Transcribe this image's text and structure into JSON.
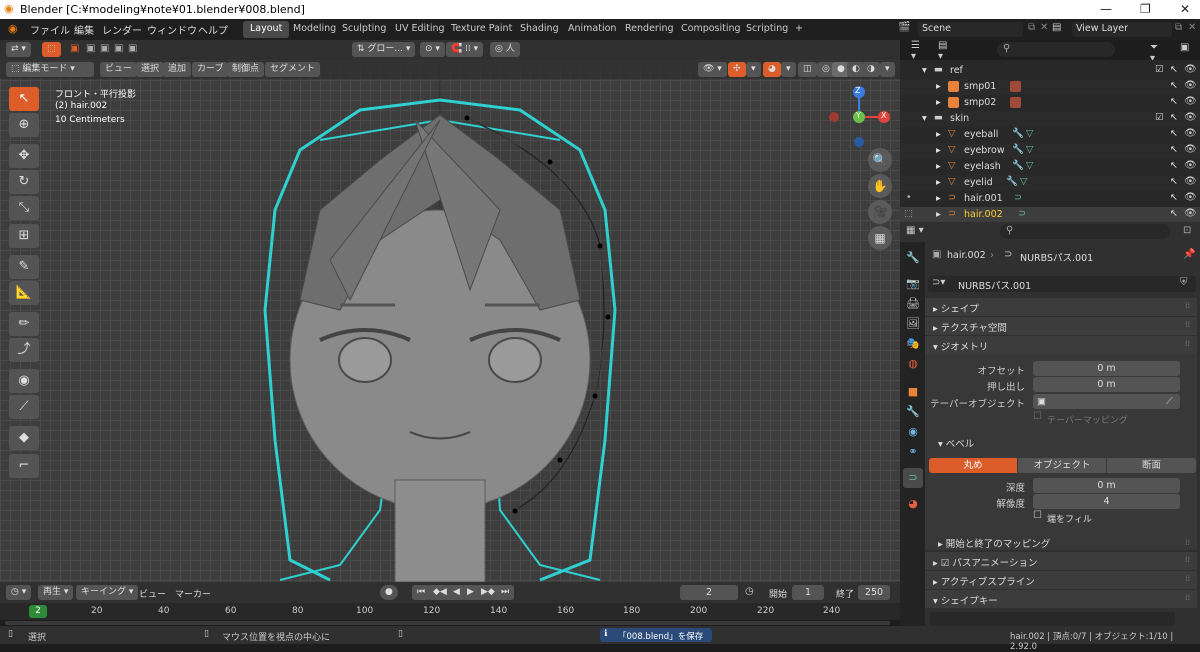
{
  "window": {
    "title": "Blender [C:¥modeling¥note¥01.blender¥008.blend]",
    "minimize": "—",
    "maximize": "❐",
    "close": "✕"
  },
  "menu": {
    "items": [
      "ファイル",
      "編集",
      "レンダー",
      "ウィンドウ",
      "ヘルプ"
    ]
  },
  "workspaces": [
    "Layout",
    "Modeling",
    "Sculpting",
    "UV Editing",
    "Texture Paint",
    "Shading",
    "Animation",
    "Rendering",
    "Compositing",
    "Scripting",
    "+"
  ],
  "scene": {
    "name": "Scene",
    "view_layer": "View Layer"
  },
  "toolbar": {
    "transform_orientation": "グロー...",
    "snap": "",
    "proportional": "人"
  },
  "viewport_header": {
    "mode": "編集モード",
    "menus": [
      "ビュー",
      "選択",
      "追加",
      "カーブ",
      "制御点",
      "セグメント"
    ]
  },
  "viewport": {
    "view_name": "フロント・平行投影",
    "object_name": "(2) hair.002",
    "scale": "10 Centimeters",
    "axes": {
      "z": "Z",
      "x": "X",
      "y": "Y"
    }
  },
  "outliner": {
    "search_placeholder": "",
    "rows": [
      {
        "name": "ref",
        "type": "collection",
        "level": 0,
        "expanded": true
      },
      {
        "name": "smp01",
        "type": "image",
        "level": 1
      },
      {
        "name": "smp02",
        "type": "image",
        "level": 1
      },
      {
        "name": "skin",
        "type": "collection",
        "level": 0,
        "expanded": true
      },
      {
        "name": "eyeball",
        "type": "mesh",
        "level": 1
      },
      {
        "name": "eyebrow",
        "type": "mesh",
        "level": 1
      },
      {
        "name": "eyelash",
        "type": "mesh",
        "level": 1
      },
      {
        "name": "eyelid",
        "type": "mesh",
        "level": 1
      },
      {
        "name": "hair.001",
        "type": "curve",
        "level": 1
      },
      {
        "name": "hair.002",
        "type": "curve",
        "level": 1,
        "active": true
      }
    ]
  },
  "properties": {
    "breadcrumb_object": "hair.002",
    "breadcrumb_data": "NURBSパス.001",
    "datablock": "NURBSパス.001",
    "sections": {
      "shape": "シェイプ",
      "texture_space": "テクスチャ空間",
      "geometry": "ジオメトリ",
      "offset_label": "オフセット",
      "offset_value": "0 m",
      "extrude_label": "押し出し",
      "extrude_value": "0 m",
      "taper_label": "テーパーオブジェクト",
      "taper_mapping": "テーパーマッピング",
      "bevel": "ベベル",
      "bevel_tabs": [
        "丸め",
        "オブジェクト",
        "断面"
      ],
      "depth_label": "深度",
      "depth_value": "0 m",
      "resolution_label": "解像度",
      "resolution_value": "4",
      "fill_caps": "端をフィル",
      "start_end_mapping": "開始と終了のマッピング",
      "path_animation": "パスアニメーション",
      "active_spline": "アクティブスプライン",
      "shape_keys": "シェイプキー"
    }
  },
  "timeline": {
    "menus": [
      "再生",
      "キーイング",
      "ビュー",
      "マーカー"
    ],
    "current_frame": "2",
    "start_label": "開始",
    "start": "1",
    "end_label": "終了",
    "end": "250",
    "ticks": [
      "2",
      "20",
      "40",
      "60",
      "80",
      "100",
      "120",
      "140",
      "160",
      "180",
      "200",
      "220",
      "240"
    ]
  },
  "status": {
    "select": "選択",
    "view_center": "マウス位置を視点の中心に",
    "saved": "「008.blend」を保存",
    "stats": "hair.002 | 頂点:0/7 | オブジェクト:1/10 | 2.92.0"
  },
  "colors": {
    "accent": "#dd5d2a",
    "cyan": "#2fd0d0",
    "active_text": "#ffcc33"
  }
}
